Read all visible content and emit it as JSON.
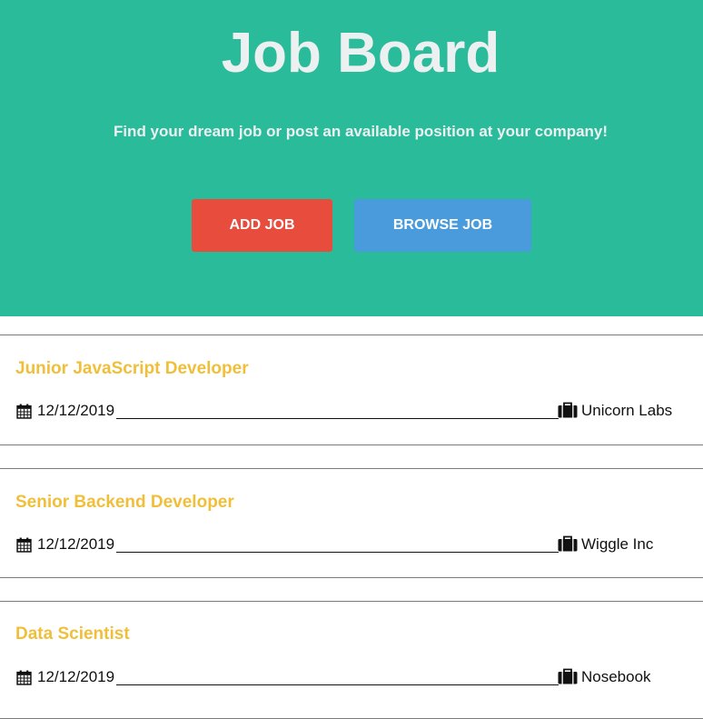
{
  "header": {
    "title": "Job Board",
    "subtitle": "Find your dream job or post an available position at your company!",
    "add_job_label": "ADD JOB",
    "browse_job_label": "BROWSE JOB"
  },
  "colors": {
    "hero_background": "#2abb9b",
    "add_button": "#e74c3c",
    "browse_button": "#4a9bdc",
    "job_title": "#f0bf3a"
  },
  "jobs": [
    {
      "title": "Junior JavaScript Developer",
      "date": "12/12/2019",
      "company": "Unicorn Labs",
      "date_icon": "calendar-icon",
      "company_icon": "briefcase-icon"
    },
    {
      "title": "Senior Backend Developer",
      "date": "12/12/2019",
      "company": "Wiggle Inc",
      "date_icon": "calendar-icon",
      "company_icon": "briefcase-icon"
    },
    {
      "title": "Data Scientist",
      "date": "12/12/2019",
      "company": "Nosebook",
      "date_icon": "calendar-icon",
      "company_icon": "briefcase-icon"
    }
  ]
}
